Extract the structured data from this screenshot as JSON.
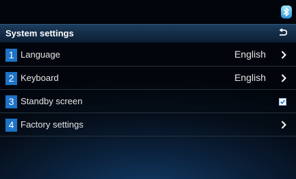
{
  "status_bar": {
    "bluetooth_icon": "bluetooth-icon"
  },
  "header": {
    "title": "System settings",
    "back_icon": "back-arrow-icon"
  },
  "menu": {
    "items": [
      {
        "number": "1",
        "label": "Language",
        "value": "English",
        "control": "chevron-right-icon"
      },
      {
        "number": "2",
        "label": "Keyboard",
        "value": "English",
        "control": "chevron-right-icon"
      },
      {
        "number": "3",
        "label": "Standby screen",
        "control": "checkbox",
        "checked": true
      },
      {
        "number": "4",
        "label": "Factory settings",
        "control": "chevron-right-icon"
      }
    ]
  },
  "colors": {
    "badge": "#1d73c7",
    "title_bar": "#1d3c5c",
    "background": "#02060c",
    "accent_glow": "#123c68"
  }
}
